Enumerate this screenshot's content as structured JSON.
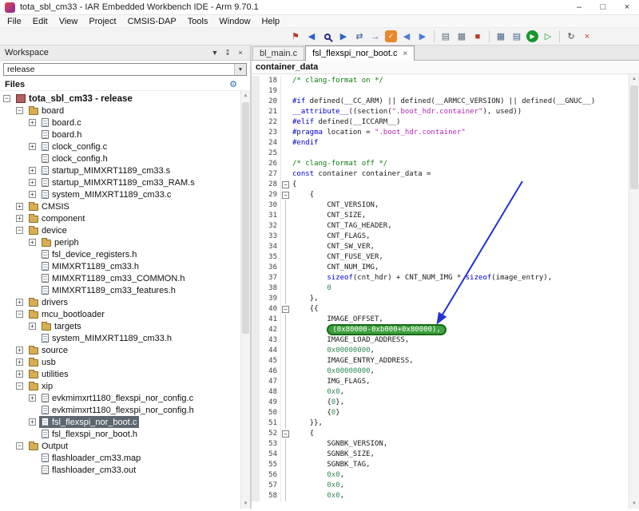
{
  "window": {
    "title": "tota_sbl_cm33 - IAR Embedded Workbench IDE - Arm 9.70.1",
    "controls": {
      "minimize": "–",
      "maximize": "□",
      "close": "×"
    }
  },
  "menubar": [
    "File",
    "Edit",
    "View",
    "Project",
    "CMSIS-DAP",
    "Tools",
    "Window",
    "Help"
  ],
  "toolbar": {
    "icons": [
      {
        "name": "bookmark-icon",
        "glyph": "⚑",
        "color": "#b03a2e"
      },
      {
        "name": "find-previous-icon",
        "glyph": "◀",
        "color": "#2b62c9"
      },
      {
        "name": "find-icon",
        "css": "mag"
      },
      {
        "name": "find-next-icon",
        "glyph": "▶",
        "color": "#2b62c9"
      },
      {
        "name": "replace-icon",
        "glyph": "⇄",
        "color": "#355f9e"
      },
      {
        "name": "go-to-icon",
        "glyph": "→",
        "color": "#355f9e"
      },
      {
        "name": "shield-icon",
        "glyph": "✓",
        "shape": "chip",
        "bg": "#e8882a",
        "color": "#ffffff"
      },
      {
        "name": "navigate-back-icon",
        "glyph": "◀",
        "color": "#4a7dd4"
      },
      {
        "name": "navigate-forward-icon",
        "glyph": "▶",
        "color": "#4a7dd4"
      },
      {
        "sep": true
      },
      {
        "name": "compile-icon",
        "glyph": "▤",
        "color": "#5a6b7d"
      },
      {
        "name": "make-icon",
        "glyph": "▦",
        "color": "#5a6b7d"
      },
      {
        "name": "stop-build-icon",
        "glyph": "■",
        "color": "#c0392b"
      },
      {
        "sep": true
      },
      {
        "name": "memory-view-icon",
        "glyph": "▦",
        "color": "#46628c"
      },
      {
        "name": "registers-view-icon",
        "glyph": "▤",
        "color": "#46628c"
      },
      {
        "name": "download-and-debug-icon",
        "glyph": "▶",
        "shape": "round",
        "bg": "#18962c",
        "color": "#ffffff"
      },
      {
        "name": "debug-without-downloading-icon",
        "glyph": "▷",
        "color": "#18962c"
      },
      {
        "sep": true
      },
      {
        "name": "reset-icon",
        "glyph": "↻",
        "color": "#444444"
      },
      {
        "name": "stop-debug-icon",
        "glyph": "×",
        "color": "#c0392b"
      }
    ]
  },
  "workspace": {
    "title": "Workspace",
    "header_icons": [
      {
        "name": "menu-dropdown-icon",
        "glyph": "▼"
      },
      {
        "name": "pin-icon",
        "glyph": "↧"
      },
      {
        "name": "close-icon",
        "glyph": "×"
      }
    ],
    "config": "release",
    "combo_caret": "▼",
    "files_label": "Files",
    "gear_glyph": "⚙",
    "tree": [
      {
        "label": "tota_sbl_cm33 - release",
        "level": 0,
        "icon": "project",
        "expand": "minus",
        "bold": true
      },
      {
        "label": "board",
        "level": 1,
        "icon": "folder",
        "expand": "minus"
      },
      {
        "label": "board.c",
        "level": 2,
        "icon": "file",
        "expand": "plus"
      },
      {
        "label": "board.h",
        "level": 2,
        "icon": "file"
      },
      {
        "label": "clock_config.c",
        "level": 2,
        "icon": "file",
        "expand": "plus"
      },
      {
        "label": "clock_config.h",
        "level": 2,
        "icon": "file"
      },
      {
        "label": "startup_MIMXRT1189_cm33.s",
        "level": 2,
        "icon": "file",
        "expand": "plus"
      },
      {
        "label": "startup_MIMXRT1189_cm33_RAM.s",
        "level": 2,
        "icon": "file",
        "expand": "plus"
      },
      {
        "label": "system_MIMXRT1189_cm33.c",
        "level": 2,
        "icon": "file",
        "expand": "plus"
      },
      {
        "label": "CMSIS",
        "level": 1,
        "icon": "folder",
        "expand": "plus"
      },
      {
        "label": "component",
        "level": 1,
        "icon": "folder",
        "expand": "plus"
      },
      {
        "label": "device",
        "level": 1,
        "icon": "folder",
        "expand": "minus"
      },
      {
        "label": "periph",
        "level": 2,
        "icon": "folder",
        "expand": "plus"
      },
      {
        "label": "fsl_device_registers.h",
        "level": 2,
        "icon": "file"
      },
      {
        "label": "MIMXRT1189_cm33.h",
        "level": 2,
        "icon": "file"
      },
      {
        "label": "MIMXRT1189_cm33_COMMON.h",
        "level": 2,
        "icon": "file"
      },
      {
        "label": "MIMXRT1189_cm33_features.h",
        "level": 2,
        "icon": "file"
      },
      {
        "label": "drivers",
        "level": 1,
        "icon": "folder",
        "expand": "plus"
      },
      {
        "label": "mcu_bootloader",
        "level": 1,
        "icon": "folder",
        "expand": "minus"
      },
      {
        "label": "targets",
        "level": 2,
        "icon": "folder",
        "expand": "plus"
      },
      {
        "label": "system_MIMXRT1189_cm33.h",
        "level": 2,
        "icon": "file"
      },
      {
        "label": "source",
        "level": 1,
        "icon": "folder",
        "expand": "plus"
      },
      {
        "label": "usb",
        "level": 1,
        "icon": "folder",
        "expand": "plus"
      },
      {
        "label": "utilities",
        "level": 1,
        "icon": "folder",
        "expand": "plus"
      },
      {
        "label": "xip",
        "level": 1,
        "icon": "folder",
        "expand": "minus"
      },
      {
        "label": "evkmimxrt1180_flexspi_nor_config.c",
        "level": 2,
        "icon": "file",
        "expand": "plus"
      },
      {
        "label": "evkmimxrt1180_flexspi_nor_config.h",
        "level": 2,
        "icon": "file"
      },
      {
        "label": "fsl_flexspi_nor_boot.c",
        "level": 2,
        "icon": "file",
        "expand": "plus",
        "selected": true
      },
      {
        "label": "fsl_flexspi_nor_boot.h",
        "level": 2,
        "icon": "file"
      },
      {
        "label": "Output",
        "level": 1,
        "icon": "folder",
        "expand": "minus"
      },
      {
        "label": "flashloader_cm33.map",
        "level": 2,
        "icon": "file"
      },
      {
        "label": "flashloader_cm33.out",
        "level": 2,
        "icon": "file"
      }
    ]
  },
  "editor": {
    "tabs": [
      {
        "label": "bl_main.c",
        "active": false
      },
      {
        "label": "fsl_flexspi_nor_boot.c",
        "active": true,
        "close_glyph": "×"
      }
    ],
    "context": "container_data",
    "code": {
      "lines": [
        {
          "n": 18,
          "segs": [
            {
              "c": "c",
              "t": "/* clang-format on */"
            }
          ]
        },
        {
          "n": 19,
          "segs": []
        },
        {
          "n": 20,
          "segs": [
            {
              "c": "d",
              "t": "#if"
            },
            {
              "c": "p",
              "t": " defined(__CC_ARM) || defined(__ARMCC_VERSION) || defined(__GNUC__)"
            }
          ]
        },
        {
          "n": 21,
          "segs": [
            {
              "c": "k",
              "t": "__attribute__"
            },
            {
              "c": "p",
              "t": "((section("
            },
            {
              "c": "s",
              "t": "\".boot_hdr.container\""
            },
            {
              "c": "p",
              "t": "), used))"
            }
          ]
        },
        {
          "n": 22,
          "segs": [
            {
              "c": "d",
              "t": "#elif"
            },
            {
              "c": "p",
              "t": " defined(__ICCARM__)"
            }
          ]
        },
        {
          "n": 23,
          "segs": [
            {
              "c": "d",
              "t": "#pragma"
            },
            {
              "c": "p",
              "t": " location = "
            },
            {
              "c": "s",
              "t": "\".boot_hdr.container\""
            }
          ]
        },
        {
          "n": 24,
          "segs": [
            {
              "c": "d",
              "t": "#endif"
            }
          ]
        },
        {
          "n": 25,
          "segs": []
        },
        {
          "n": 26,
          "segs": [
            {
              "c": "c",
              "t": "/* clang-format off */"
            }
          ]
        },
        {
          "n": 27,
          "segs": [
            {
              "c": "k",
              "t": "const"
            },
            {
              "c": "p",
              "t": " container container_data ="
            }
          ]
        },
        {
          "n": 28,
          "fold": true,
          "segs": [
            {
              "c": "p",
              "t": "{"
            }
          ]
        },
        {
          "n": 29,
          "fold": true,
          "segs": [
            {
              "c": "p",
              "t": "    {"
            }
          ]
        },
        {
          "n": 30,
          "guide": true,
          "segs": [
            {
              "c": "p",
              "t": "        CNT_VERSION,"
            }
          ]
        },
        {
          "n": 31,
          "guide": true,
          "segs": [
            {
              "c": "p",
              "t": "        CNT_SIZE,"
            }
          ]
        },
        {
          "n": 32,
          "guide": true,
          "segs": [
            {
              "c": "p",
              "t": "        CNT_TAG_HEADER,"
            }
          ]
        },
        {
          "n": 33,
          "guide": true,
          "segs": [
            {
              "c": "p",
              "t": "        CNT_FLAGS,"
            }
          ]
        },
        {
          "n": 34,
          "guide": true,
          "segs": [
            {
              "c": "p",
              "t": "        CNT_SW_VER,"
            }
          ]
        },
        {
          "n": 35,
          "guide": true,
          "segs": [
            {
              "c": "p",
              "t": "        CNT_FUSE_VER,"
            }
          ]
        },
        {
          "n": 36,
          "guide": true,
          "segs": [
            {
              "c": "p",
              "t": "        CNT_NUM_IMG,"
            }
          ]
        },
        {
          "n": 37,
          "guide": true,
          "segs": [
            {
              "c": "p",
              "t": "        "
            },
            {
              "c": "k",
              "t": "sizeof"
            },
            {
              "c": "p",
              "t": "(cnt_hdr) + CNT_NUM_IMG * "
            },
            {
              "c": "k",
              "t": "sizeof"
            },
            {
              "c": "p",
              "t": "(image_entry),"
            }
          ]
        },
        {
          "n": 38,
          "guide": true,
          "segs": [
            {
              "c": "p",
              "t": "        "
            },
            {
              "c": "n",
              "t": "0"
            }
          ]
        },
        {
          "n": 39,
          "guide": true,
          "segs": [
            {
              "c": "p",
              "t": "    },"
            }
          ]
        },
        {
          "n": 40,
          "fold": true,
          "segs": [
            {
              "c": "p",
              "t": "    {{"
            }
          ]
        },
        {
          "n": 41,
          "guide": true,
          "segs": [
            {
              "c": "p",
              "t": "        IMAGE_OFFSET,"
            }
          ]
        },
        {
          "n": 42,
          "guide": true,
          "segs": [
            {
              "c": "p",
              "t": "        "
            },
            {
              "c": "h",
              "t": "(0x80000-0xb000+0x80000),"
            }
          ]
        },
        {
          "n": 43,
          "guide": true,
          "segs": [
            {
              "c": "p",
              "t": "        IMAGE_LOAD_ADDRESS,"
            }
          ]
        },
        {
          "n": 44,
          "guide": true,
          "segs": [
            {
              "c": "p",
              "t": "        "
            },
            {
              "c": "n",
              "t": "0x00000000"
            },
            {
              "c": "p",
              "t": ","
            }
          ]
        },
        {
          "n": 45,
          "guide": true,
          "segs": [
            {
              "c": "p",
              "t": "        IMAGE_ENTRY_ADDRESS,"
            }
          ]
        },
        {
          "n": 46,
          "guide": true,
          "segs": [
            {
              "c": "p",
              "t": "        "
            },
            {
              "c": "n",
              "t": "0x00000000"
            },
            {
              "c": "p",
              "t": ","
            }
          ]
        },
        {
          "n": 47,
          "guide": true,
          "segs": [
            {
              "c": "p",
              "t": "        IMG_FLAGS,"
            }
          ]
        },
        {
          "n": 48,
          "guide": true,
          "segs": [
            {
              "c": "p",
              "t": "        "
            },
            {
              "c": "n",
              "t": "0x0"
            },
            {
              "c": "p",
              "t": ","
            }
          ]
        },
        {
          "n": 49,
          "guide": true,
          "segs": [
            {
              "c": "p",
              "t": "        {"
            },
            {
              "c": "n",
              "t": "0"
            },
            {
              "c": "p",
              "t": "},"
            }
          ]
        },
        {
          "n": 50,
          "guide": true,
          "segs": [
            {
              "c": "p",
              "t": "        {"
            },
            {
              "c": "n",
              "t": "0"
            },
            {
              "c": "p",
              "t": "}"
            }
          ]
        },
        {
          "n": 51,
          "guide": true,
          "segs": [
            {
              "c": "p",
              "t": "    }},"
            }
          ]
        },
        {
          "n": 52,
          "fold": true,
          "segs": [
            {
              "c": "p",
              "t": "    {"
            }
          ]
        },
        {
          "n": 53,
          "guide": true,
          "segs": [
            {
              "c": "p",
              "t": "        SGNBK_VERSION,"
            }
          ]
        },
        {
          "n": 54,
          "guide": true,
          "segs": [
            {
              "c": "p",
              "t": "        SGNBK_SIZE,"
            }
          ]
        },
        {
          "n": 55,
          "guide": true,
          "segs": [
            {
              "c": "p",
              "t": "        SGNBK_TAG,"
            }
          ]
        },
        {
          "n": 56,
          "guide": true,
          "segs": [
            {
              "c": "p",
              "t": "        "
            },
            {
              "c": "n",
              "t": "0x0"
            },
            {
              "c": "p",
              "t": ","
            }
          ]
        },
        {
          "n": 57,
          "guide": true,
          "segs": [
            {
              "c": "p",
              "t": "        "
            },
            {
              "c": "n",
              "t": "0x0"
            },
            {
              "c": "p",
              "t": ","
            }
          ]
        },
        {
          "n": 58,
          "guide": true,
          "segs": [
            {
              "c": "p",
              "t": "        "
            },
            {
              "c": "n",
              "t": "0x0"
            },
            {
              "c": "p",
              "t": ","
            }
          ]
        }
      ]
    }
  },
  "colors": {
    "selection_bg": "#5d6771",
    "highlight_green": "#3fa03f",
    "highlight_border": "#166b16",
    "annotation_arrow_blue": "#2433d0",
    "comment_green": "#0c7d0c",
    "directive_blue": "#0000cd",
    "string_magenta": "#b326b3"
  }
}
